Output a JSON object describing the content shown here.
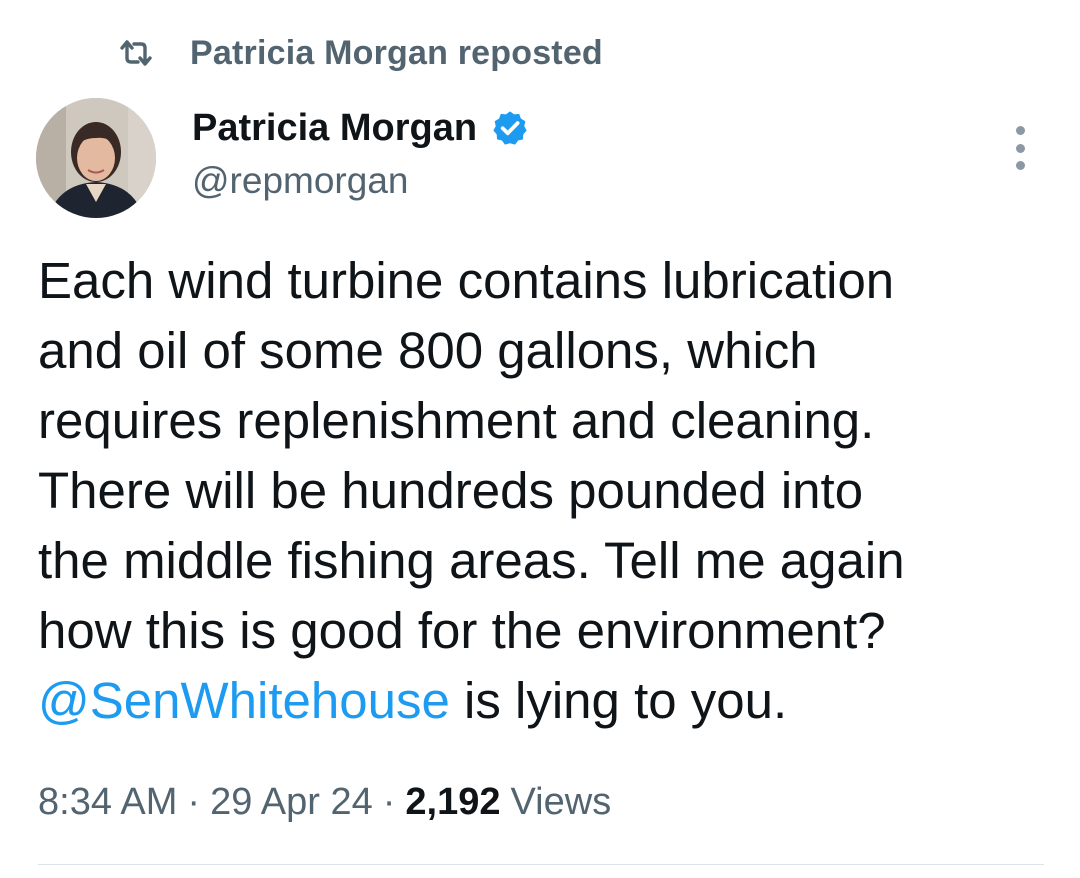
{
  "repost": {
    "icon": "repost-icon",
    "text": "Patricia Morgan reposted"
  },
  "author": {
    "avatar": "avatar",
    "display_name": "Patricia Morgan",
    "verified_icon": "verified-badge-icon",
    "handle": "@repmorgan"
  },
  "more_menu": {
    "icon": "more-options-icon"
  },
  "tweet": {
    "lines": [
      "Each wind turbine contains lubrication",
      "and oil of some 800 gallons, which",
      "requires replenishment and cleaning.",
      "There will be hundreds pounded into",
      "the middle fishing areas. Tell me again",
      "how this is good for the environment?"
    ],
    "mention": "@SenWhitehouse",
    "last_line_rest": " is lying to you."
  },
  "meta": {
    "time": "8:34 AM",
    "separator": "·",
    "date": "29 Apr 24",
    "views_count": "2,192",
    "views_label": "Views"
  },
  "colors": {
    "accent": "#1d9bf0",
    "secondary_text": "#536471",
    "primary_text": "#0f1419",
    "divider": "#dde3e8"
  }
}
